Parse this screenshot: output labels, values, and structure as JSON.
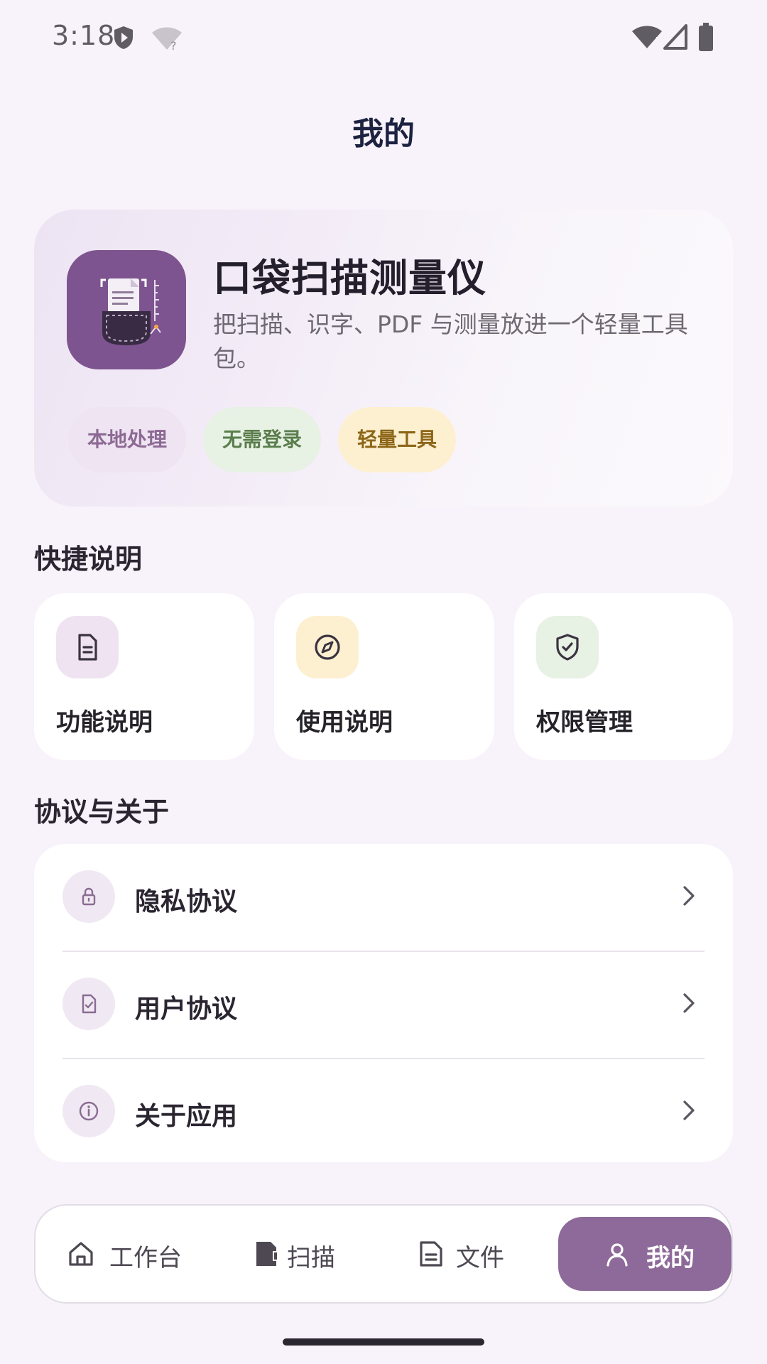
{
  "status_bar": {
    "time": "3:18"
  },
  "header": {
    "title": "我的"
  },
  "hero": {
    "app_name": "口袋扫描测量仪",
    "description": "把扫描、识字、PDF 与测量放进一个轻量工具包。",
    "tags": [
      "本地处理",
      "无需登录",
      "轻量工具"
    ]
  },
  "quick_section": {
    "title": "快捷说明",
    "cards": [
      {
        "label": "功能说明",
        "icon": "document-icon",
        "icon_bg": "#efe3f2"
      },
      {
        "label": "使用说明",
        "icon": "compass-icon",
        "icon_bg": "#fdf0d1"
      },
      {
        "label": "权限管理",
        "icon": "shield-check-icon",
        "icon_bg": "#e7f1e4"
      }
    ]
  },
  "about_section": {
    "title": "协议与关于",
    "items": [
      {
        "label": "隐私协议",
        "icon": "lock-icon"
      },
      {
        "label": "用户协议",
        "icon": "file-check-icon"
      },
      {
        "label": "关于应用",
        "icon": "info-icon"
      }
    ]
  },
  "bottom_nav": {
    "items": [
      {
        "label": "工作台",
        "icon": "home-icon"
      },
      {
        "label": "扫描",
        "icon": "scan-icon"
      },
      {
        "label": "文件",
        "icon": "file-icon"
      },
      {
        "label": "我的",
        "icon": "user-icon",
        "active": true
      }
    ]
  },
  "colors": {
    "primary": "#8d6a99",
    "background": "#f8f3fa",
    "title": "#1c2240"
  }
}
